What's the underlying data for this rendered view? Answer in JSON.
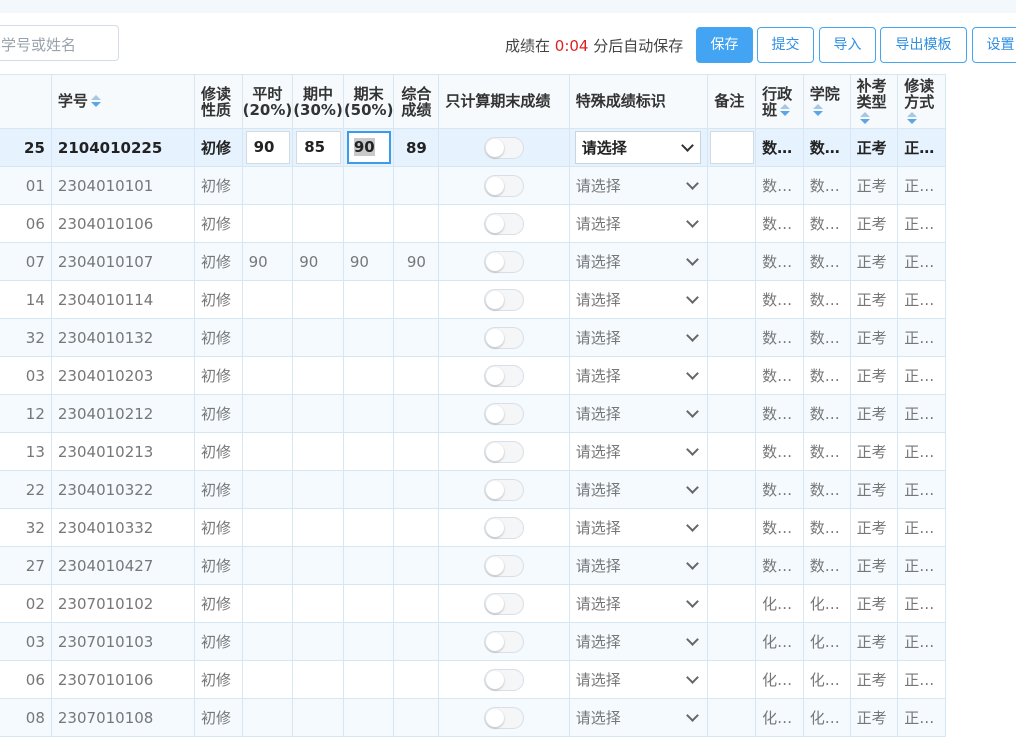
{
  "toolbar": {
    "search_placeholder": "学号或姓名",
    "autosave_prefix": "成绩在 ",
    "autosave_time": "0:04",
    "autosave_suffix": " 分后自动保存",
    "save_label": "保存",
    "submit_label": "提交",
    "import_label": "导入",
    "export_template_label": "导出模板",
    "settings_label": "设置"
  },
  "columns": {
    "student_id": "学号",
    "study_nature": "修读性质",
    "regular": "平时(20%)",
    "midterm": "期中(30%)",
    "final": "期末(50%)",
    "overall": "综合成绩",
    "final_only": "只计算期末成绩",
    "special_mark": "特殊成绩标识",
    "remark": "备注",
    "admin_class": "行政班",
    "college": "学院",
    "makeup_type": "补考类型",
    "study_mode": "修读方式"
  },
  "rows": [
    {
      "tail": "25",
      "id": "2104010225",
      "nature": "初修",
      "regular": "90",
      "midterm": "85",
      "final": "90",
      "overall": "89",
      "special": "请选择",
      "admin_class": "数…",
      "college": "数…",
      "makeup": "正考",
      "mode": "正…"
    },
    {
      "tail": "01",
      "id": "2304010101",
      "nature": "初修",
      "regular": "",
      "midterm": "",
      "final": "",
      "overall": "",
      "special": "请选择",
      "admin_class": "数…",
      "college": "数…",
      "makeup": "正考",
      "mode": "正…"
    },
    {
      "tail": "06",
      "id": "2304010106",
      "nature": "初修",
      "regular": "",
      "midterm": "",
      "final": "",
      "overall": "",
      "special": "请选择",
      "admin_class": "数…",
      "college": "数…",
      "makeup": "正考",
      "mode": "正…"
    },
    {
      "tail": "07",
      "id": "2304010107",
      "nature": "初修",
      "regular": "90",
      "midterm": "90",
      "final": "90",
      "overall": "90",
      "special": "请选择",
      "admin_class": "数…",
      "college": "数…",
      "makeup": "正考",
      "mode": "正…"
    },
    {
      "tail": "14",
      "id": "2304010114",
      "nature": "初修",
      "regular": "",
      "midterm": "",
      "final": "",
      "overall": "",
      "special": "请选择",
      "admin_class": "数…",
      "college": "数…",
      "makeup": "正考",
      "mode": "正…"
    },
    {
      "tail": "32",
      "id": "2304010132",
      "nature": "初修",
      "regular": "",
      "midterm": "",
      "final": "",
      "overall": "",
      "special": "请选择",
      "admin_class": "数…",
      "college": "数…",
      "makeup": "正考",
      "mode": "正…"
    },
    {
      "tail": "03",
      "id": "2304010203",
      "nature": "初修",
      "regular": "",
      "midterm": "",
      "final": "",
      "overall": "",
      "special": "请选择",
      "admin_class": "数…",
      "college": "数…",
      "makeup": "正考",
      "mode": "正…"
    },
    {
      "tail": "12",
      "id": "2304010212",
      "nature": "初修",
      "regular": "",
      "midterm": "",
      "final": "",
      "overall": "",
      "special": "请选择",
      "admin_class": "数…",
      "college": "数…",
      "makeup": "正考",
      "mode": "正…"
    },
    {
      "tail": "13",
      "id": "2304010213",
      "nature": "初修",
      "regular": "",
      "midterm": "",
      "final": "",
      "overall": "",
      "special": "请选择",
      "admin_class": "数…",
      "college": "数…",
      "makeup": "正考",
      "mode": "正…"
    },
    {
      "tail": "22",
      "id": "2304010322",
      "nature": "初修",
      "regular": "",
      "midterm": "",
      "final": "",
      "overall": "",
      "special": "请选择",
      "admin_class": "数…",
      "college": "数…",
      "makeup": "正考",
      "mode": "正…"
    },
    {
      "tail": "32",
      "id": "2304010332",
      "nature": "初修",
      "regular": "",
      "midterm": "",
      "final": "",
      "overall": "",
      "special": "请选择",
      "admin_class": "数…",
      "college": "数…",
      "makeup": "正考",
      "mode": "正…"
    },
    {
      "tail": "27",
      "id": "2304010427",
      "nature": "初修",
      "regular": "",
      "midterm": "",
      "final": "",
      "overall": "",
      "special": "请选择",
      "admin_class": "数…",
      "college": "数…",
      "makeup": "正考",
      "mode": "正…"
    },
    {
      "tail": "02",
      "id": "2307010102",
      "nature": "初修",
      "regular": "",
      "midterm": "",
      "final": "",
      "overall": "",
      "special": "请选择",
      "admin_class": "化…",
      "college": "化…",
      "makeup": "正考",
      "mode": "正…"
    },
    {
      "tail": "03",
      "id": "2307010103",
      "nature": "初修",
      "regular": "",
      "midterm": "",
      "final": "",
      "overall": "",
      "special": "请选择",
      "admin_class": "化…",
      "college": "化…",
      "makeup": "正考",
      "mode": "正…"
    },
    {
      "tail": "06",
      "id": "2307010106",
      "nature": "初修",
      "regular": "",
      "midterm": "",
      "final": "",
      "overall": "",
      "special": "请选择",
      "admin_class": "化…",
      "college": "化…",
      "makeup": "正考",
      "mode": "正…"
    },
    {
      "tail": "08",
      "id": "2307010108",
      "nature": "初修",
      "regular": "",
      "midterm": "",
      "final": "",
      "overall": "",
      "special": "请选择",
      "admin_class": "化…",
      "college": "化…",
      "makeup": "正考",
      "mode": "正…"
    }
  ]
}
